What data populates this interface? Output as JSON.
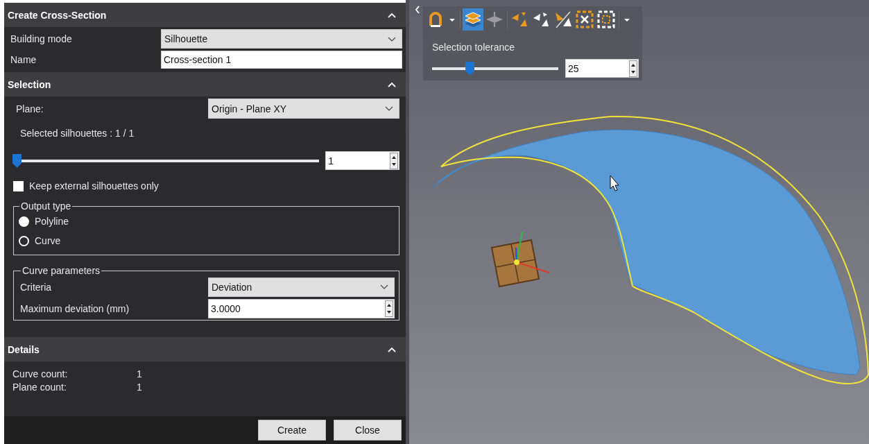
{
  "create_section": {
    "title": "Create Cross-Section",
    "expanded": true,
    "building_mode": {
      "label": "Building mode",
      "value": "Silhouette"
    },
    "name": {
      "label": "Name",
      "value": "Cross-section 1"
    }
  },
  "selection_section": {
    "title": "Selection",
    "expanded": true,
    "plane": {
      "label": "Plane:",
      "value": "Origin - Plane XY"
    },
    "selected_silhouettes": "Selected silhouettes : 1 / 1",
    "silhouette_slider": {
      "level": 0,
      "value": "1"
    },
    "keep_external": {
      "label": "Keep external silhouettes only",
      "checked": false
    },
    "output_type": {
      "legend": "Output type",
      "options": [
        {
          "label": "Polyline",
          "selected": true
        },
        {
          "label": "Curve",
          "selected": false
        }
      ]
    },
    "curve_parameters": {
      "legend": "Curve parameters",
      "criteria": {
        "label": "Criteria",
        "value": "Deviation"
      },
      "max_deviation": {
        "label": "Maximum deviation (mm)",
        "value": "3.0000"
      }
    }
  },
  "details_section": {
    "title": "Details",
    "expanded": true,
    "rows": [
      {
        "label": "Curve count:",
        "value": "1"
      },
      {
        "label": "Plane count:",
        "value": "1"
      }
    ]
  },
  "buttons": [
    "Create",
    "Close"
  ],
  "viewport_toolbar": {
    "tools": [
      {
        "kind": "arch",
        "selected": false
      },
      {
        "kind": "caret",
        "selected": false
      },
      {
        "kind": "layers",
        "selected": true
      },
      {
        "kind": "layers-grey",
        "selected": false
      },
      {
        "kind": "tri-out",
        "selected": false
      },
      {
        "kind": "tri-in",
        "selected": false
      },
      {
        "kind": "tri-split",
        "selected": false
      },
      {
        "kind": "frame-in",
        "selected": false
      },
      {
        "kind": "frame-out",
        "selected": false
      },
      {
        "kind": "caret",
        "selected": false
      }
    ],
    "tolerance": {
      "label": "Selection tolerance",
      "level": 0.27,
      "value": "25"
    }
  }
}
